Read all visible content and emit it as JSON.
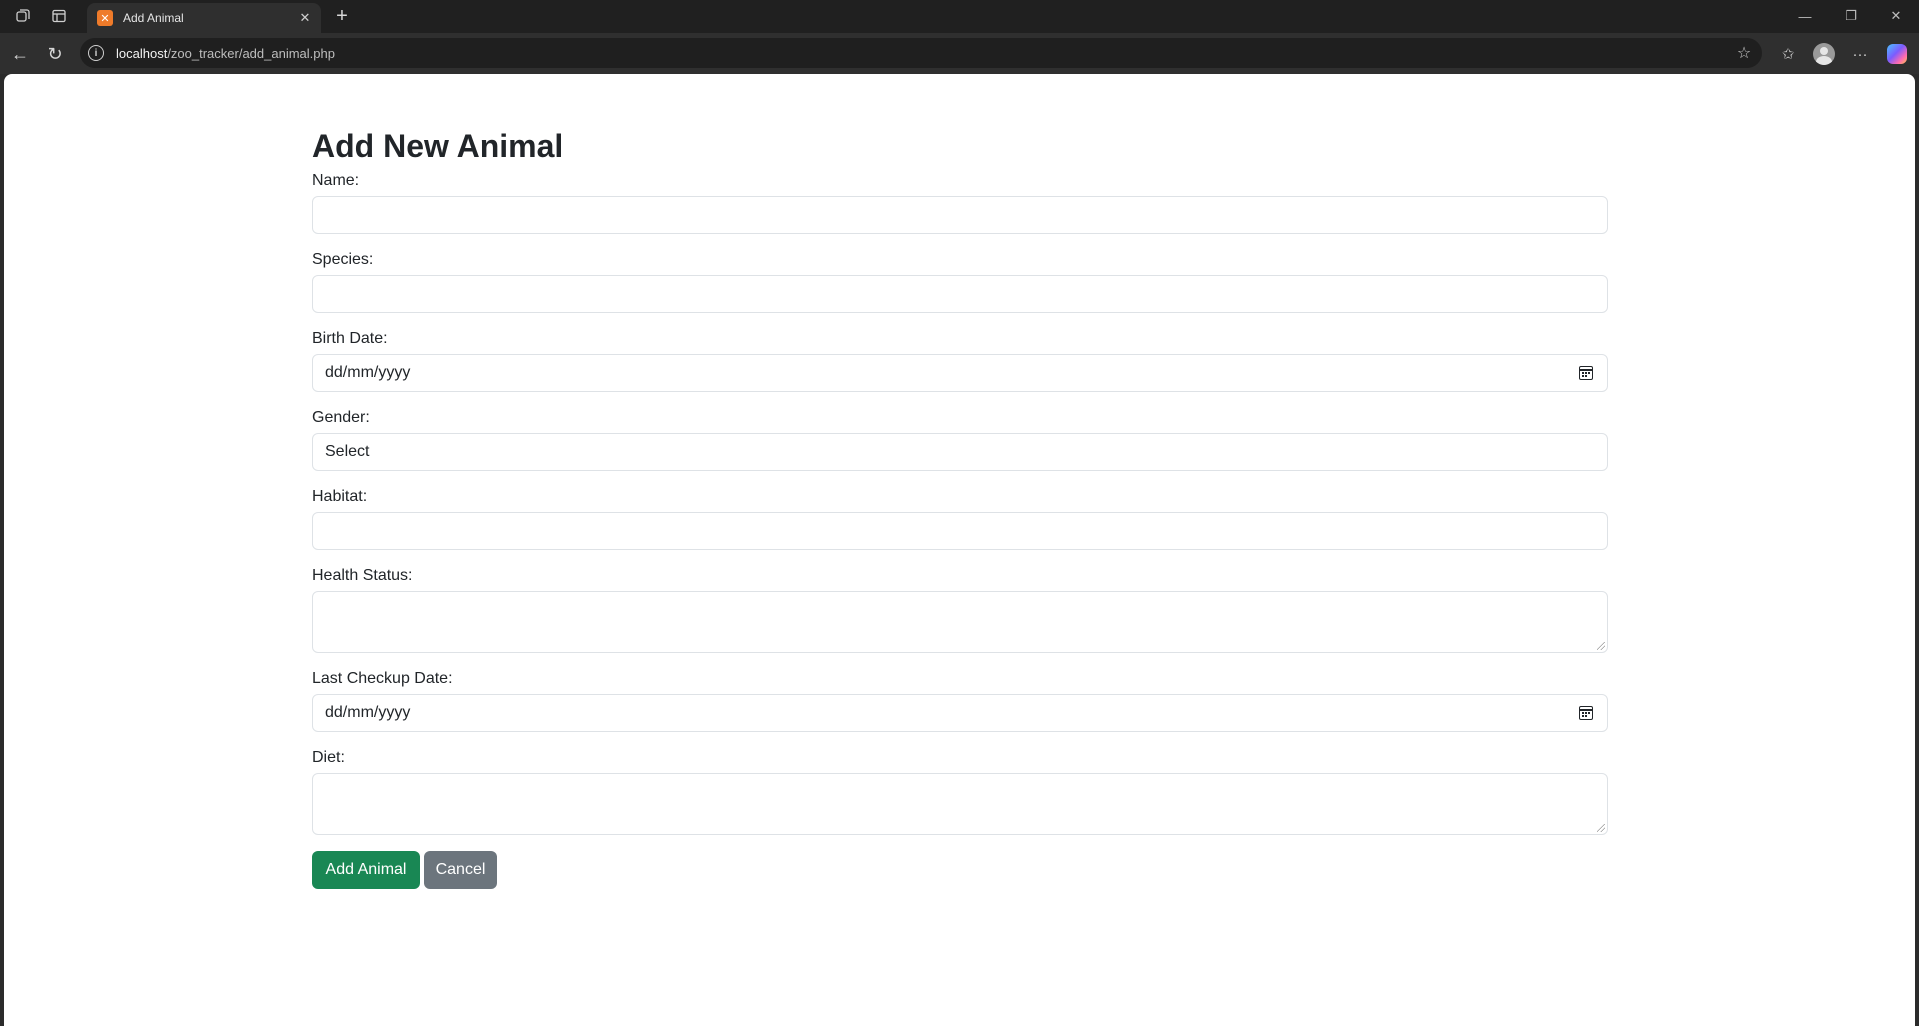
{
  "browser": {
    "tab_title": "Add Animal",
    "tab_favicon_letter": "✕",
    "url_host": "localhost",
    "url_path": "/zoo_tracker/add_animal.php"
  },
  "page": {
    "title": "Add New Animal",
    "fields": {
      "name_label": "Name:",
      "species_label": "Species:",
      "birth_date_label": "Birth Date:",
      "birth_date_placeholder": "dd/mm/yyyy",
      "gender_label": "Gender:",
      "gender_selected": "Select",
      "habitat_label": "Habitat:",
      "health_status_label": "Health Status:",
      "last_checkup_label": "Last Checkup Date:",
      "last_checkup_placeholder": "dd/mm/yyyy",
      "diet_label": "Diet:"
    },
    "buttons": {
      "submit": "Add Animal",
      "cancel": "Cancel"
    }
  },
  "colors": {
    "submit_bg": "#198754",
    "cancel_bg": "#6c757d",
    "chrome_bg": "#202020"
  },
  "icons": [
    "workspaces-icon",
    "tab-actions-icon",
    "xampp-favicon-icon",
    "close-icon",
    "new-tab-icon",
    "minimize-icon",
    "restore-icon",
    "window-close-icon",
    "back-icon",
    "refresh-icon",
    "info-icon",
    "star-icon",
    "favorites-icon",
    "profile-icon",
    "more-icon",
    "copilot-icon",
    "calendar-icon"
  ]
}
